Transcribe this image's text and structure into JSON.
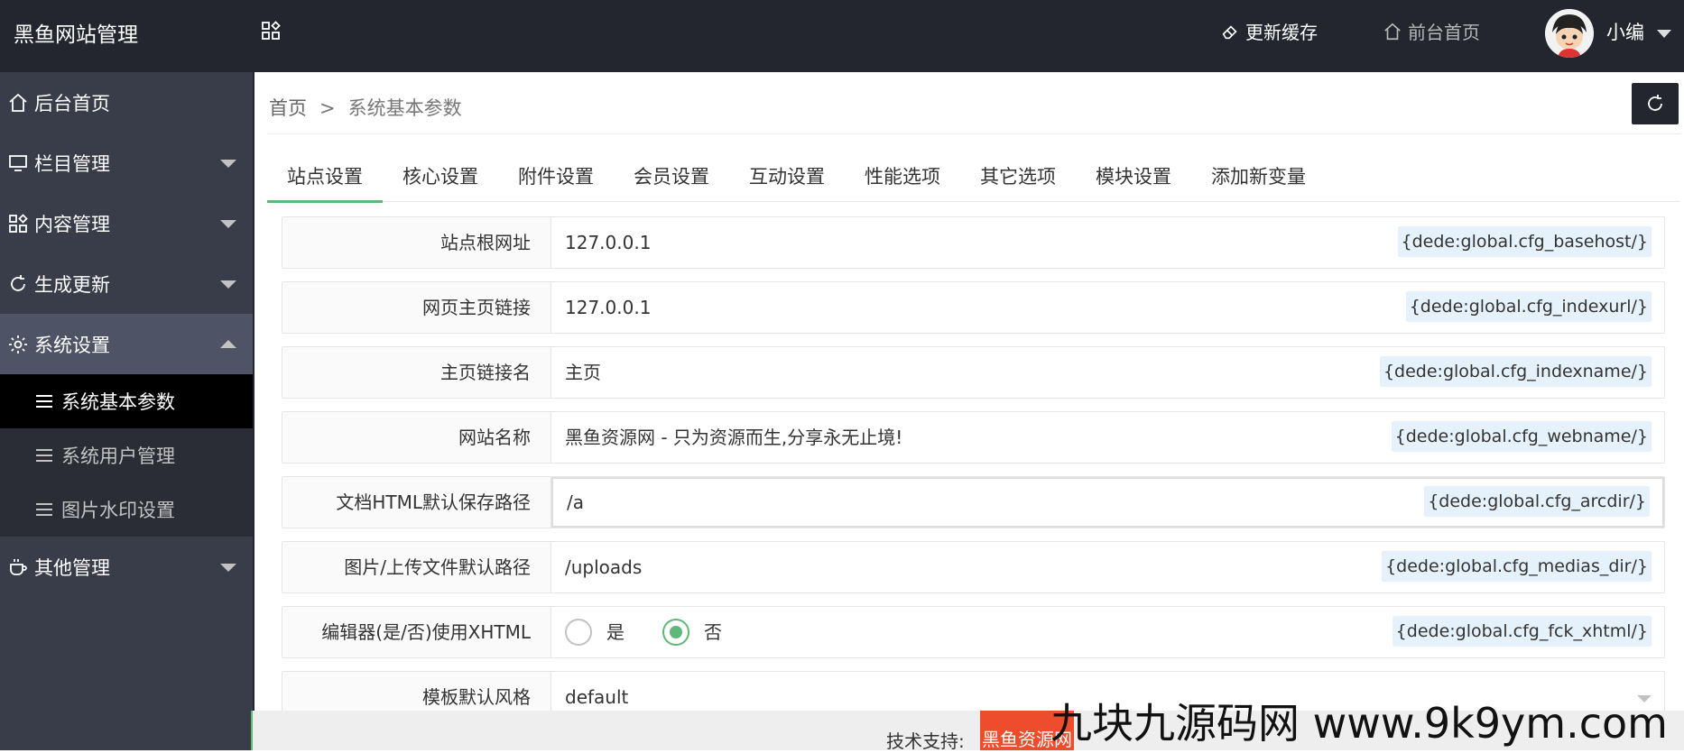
{
  "app": {
    "title": "黑鱼网站管理"
  },
  "header": {
    "cache_label": "更新缓存",
    "front_label": "前台首页",
    "user_name": "小编"
  },
  "sidebar": {
    "items": [
      {
        "label": "后台首页"
      },
      {
        "label": "栏目管理"
      },
      {
        "label": "内容管理"
      },
      {
        "label": "生成更新"
      },
      {
        "label": "系统设置"
      },
      {
        "label": "其他管理"
      }
    ],
    "sub_items": [
      {
        "label": "系统基本参数"
      },
      {
        "label": "系统用户管理"
      },
      {
        "label": "图片水印设置"
      }
    ]
  },
  "breadcrumb": {
    "home": "首页",
    "separator": ">",
    "current": "系统基本参数"
  },
  "tabs": [
    {
      "label": "站点设置"
    },
    {
      "label": "核心设置"
    },
    {
      "label": "附件设置"
    },
    {
      "label": "会员设置"
    },
    {
      "label": "互动设置"
    },
    {
      "label": "性能选项"
    },
    {
      "label": "其它选项"
    },
    {
      "label": "模块设置"
    },
    {
      "label": "添加新变量"
    }
  ],
  "form": {
    "rows": [
      {
        "label": "站点根网址",
        "value": "127.0.0.1",
        "tag": "{dede:global.cfg_basehost/}"
      },
      {
        "label": "网页主页链接",
        "value": "127.0.0.1",
        "tag": "{dede:global.cfg_indexurl/}"
      },
      {
        "label": "主页链接名",
        "value": "主页",
        "tag": "{dede:global.cfg_indexname/}"
      },
      {
        "label": "网站名称",
        "value": "黑鱼资源网 - 只为资源而生,分享永无止境!",
        "tag": "{dede:global.cfg_webname/}"
      },
      {
        "label": "文档HTML默认保存路径",
        "value": "/a",
        "tag": "{dede:global.cfg_arcdir/}"
      },
      {
        "label": "图片/上传文件默认路径",
        "value": "/uploads",
        "tag": "{dede:global.cfg_medias_dir/}"
      },
      {
        "label": "编辑器(是/否)使用XHTML",
        "radio_yes": "是",
        "radio_no": "否",
        "tag": "{dede:global.cfg_fck_xhtml/}"
      },
      {
        "label": "模板默认风格",
        "value": "default"
      }
    ]
  },
  "footer": {
    "support_label": "技术支持:",
    "brand": "黑鱼资源网"
  },
  "watermark": "九块九源码网 www.9k9ym.com",
  "colors": {
    "accent": "#5fb878",
    "topbar": "#23262e",
    "sidebar": "#393d49",
    "brand": "#ee4d2d"
  }
}
